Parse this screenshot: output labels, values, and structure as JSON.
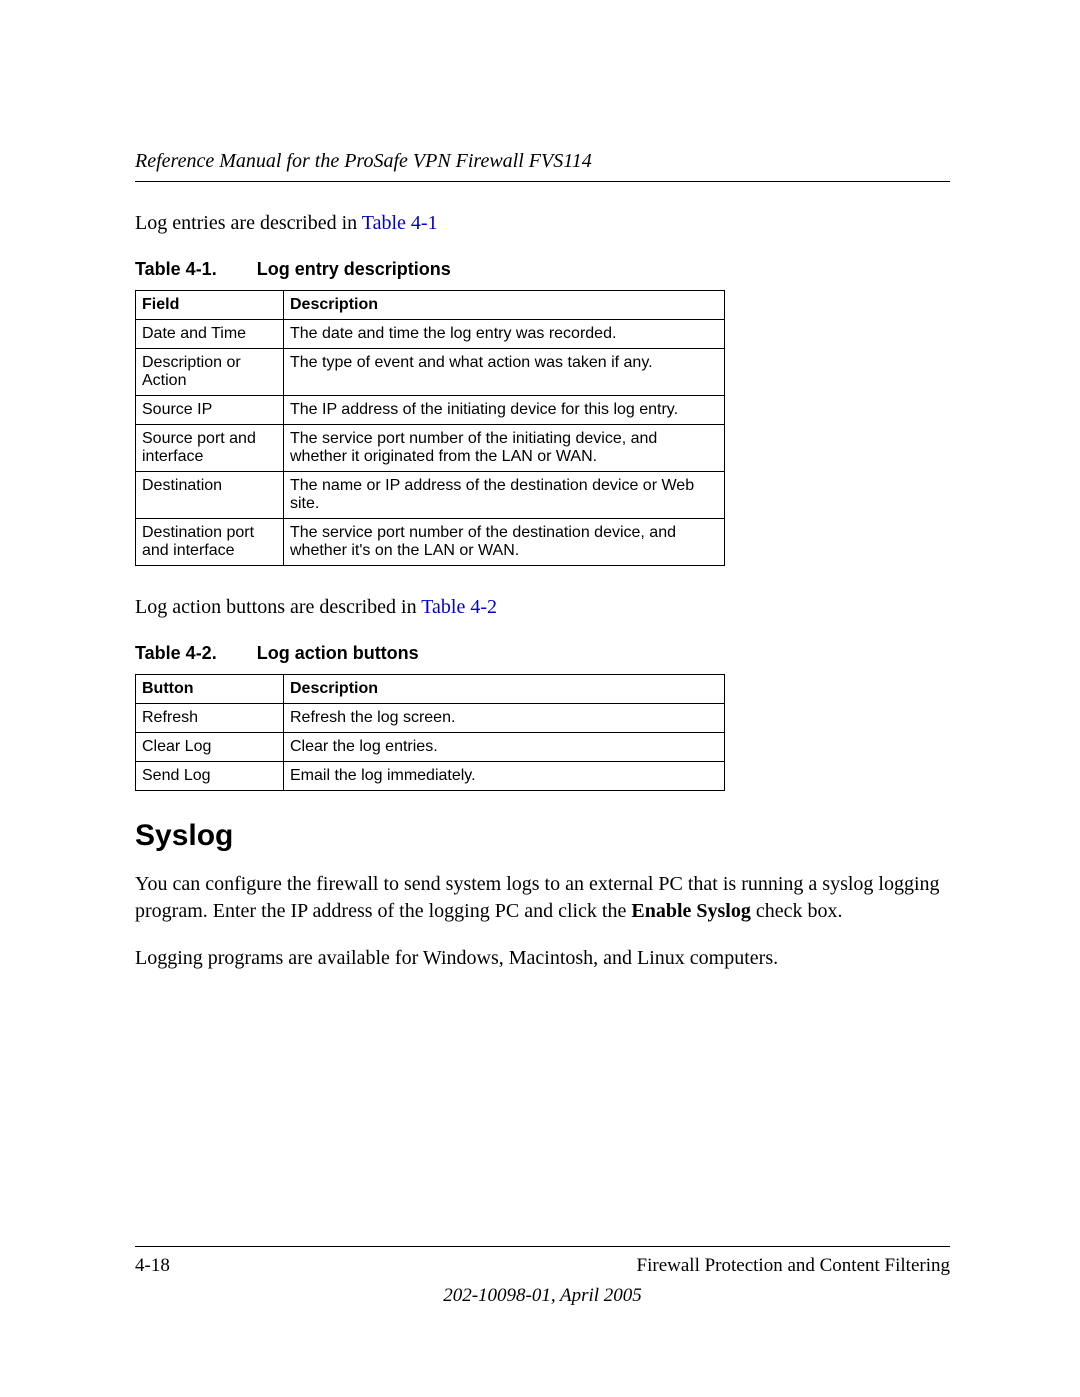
{
  "header": {
    "running_head": "Reference Manual for the ProSafe VPN Firewall FVS114"
  },
  "para1": {
    "prefix": "Log entries are described in ",
    "xref": "Table 4-1"
  },
  "table1": {
    "caption_num": "Table 4-1.",
    "caption_title": "Log entry descriptions",
    "headers": {
      "field": "Field",
      "desc": "Description"
    },
    "rows": [
      {
        "field": "Date and Time",
        "desc": "The date and time the log entry was recorded."
      },
      {
        "field": "Description or Action",
        "desc": "The type of event and what action was taken if any."
      },
      {
        "field": "Source IP",
        "desc": "The IP address of the initiating device for this log entry."
      },
      {
        "field": "Source port and interface",
        "desc": "The service port number of the initiating device, and whether it originated from the LAN or WAN."
      },
      {
        "field": "Destination",
        "desc": "The name or IP address of the destination device or Web site."
      },
      {
        "field": "Destination port and interface",
        "desc": "The service port number of the destination device, and whether it's on the LAN or WAN."
      }
    ]
  },
  "para2": {
    "prefix": "Log action buttons are described in ",
    "xref": "Table 4-2"
  },
  "table2": {
    "caption_num": "Table 4-2.",
    "caption_title": "Log action buttons",
    "headers": {
      "field": "Button",
      "desc": "Description"
    },
    "rows": [
      {
        "field": "Refresh",
        "desc": "Refresh the log screen."
      },
      {
        "field": "Clear Log",
        "desc": "Clear the log entries."
      },
      {
        "field": "Send Log",
        "desc": "Email the log immediately."
      }
    ]
  },
  "section": {
    "heading": "Syslog",
    "p1_a": "You can configure the firewall to send system logs to an external PC that is running a syslog logging program. Enter the IP address of the logging PC and click the ",
    "p1_bold": "Enable Syslog",
    "p1_b": " check box.",
    "p2": "Logging programs are available for Windows, Macintosh, and Linux computers."
  },
  "footer": {
    "page_num": "4-18",
    "chapter": "Firewall Protection and Content Filtering",
    "docline": "202-10098-01, April 2005"
  }
}
